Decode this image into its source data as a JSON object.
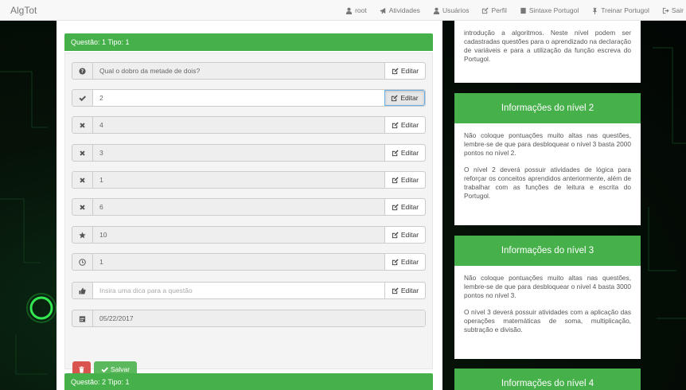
{
  "nav": {
    "brand": "AlgTot",
    "links": [
      {
        "label": "root",
        "icon": "user-icon"
      },
      {
        "label": "Atividades",
        "icon": "bullhorn-icon"
      },
      {
        "label": "Usuários",
        "icon": "user-icon"
      },
      {
        "label": "Perfil",
        "icon": "edit-icon"
      },
      {
        "label": "Sintaxe Portugol",
        "icon": "book-icon"
      },
      {
        "label": "Treinar Portugol",
        "icon": "pushpin-icon"
      },
      {
        "label": "Sair",
        "icon": "log-out-icon"
      }
    ]
  },
  "questions": [
    {
      "header": "Questão: 1 Tipo: 1",
      "rows": [
        {
          "icon": "question-icon",
          "value": "Qual o dobro da metade de dois?",
          "edit": "Editar"
        },
        {
          "icon": "check-icon",
          "value": "2",
          "edit": "Editar"
        },
        {
          "icon": "times-icon",
          "value": "4",
          "edit": "Editar"
        },
        {
          "icon": "times-icon",
          "value": "3",
          "edit": "Editar"
        },
        {
          "icon": "times-icon",
          "value": "1",
          "edit": "Editar"
        },
        {
          "icon": "times-icon",
          "value": "6",
          "edit": "Editar"
        },
        {
          "icon": "star-icon",
          "value": "10",
          "edit": "Editar"
        },
        {
          "icon": "clock-icon",
          "value": "1",
          "edit": "Editar"
        },
        {
          "icon": "thumbs-up-icon",
          "placeholder": "Insira uma dica para a questão",
          "edit": "Editar"
        }
      ],
      "date": {
        "icon": "calendar-icon",
        "value": "05/22/2017"
      },
      "save_label": "Salvar"
    },
    {
      "header": "Questão: 2 Tipo: 1"
    }
  ],
  "info": [
    {
      "title": "",
      "paragraphs": [
        "introdução a algoritmos. Neste nível podem ser cadastradas questões para o aprendizado na declaração de variáveis e para a utilização da função escreva do Portugol."
      ]
    },
    {
      "title": "Informações do nível 2",
      "paragraphs": [
        "Não coloque pontuações muito altas nas questões, lembre-se de que para desbloquear o nível 3 basta 2000 pontos no nível 2.",
        "O nível 2 deverá possuir atividades de lógica para reforçar os conceitos aprendidos anteriormente, além de trabalhar com as funções de leitura e escrita do Portugol."
      ]
    },
    {
      "title": "Informações do nível 3",
      "paragraphs": [
        "Não coloque pontuações muito altas nas questões, lembre-se de que para desbloquear o nível 4 basta 3000 pontos no nível 3.",
        "O nível 3 deverá possuir atividades com a aplicação das operações matemáticas de soma, multiplicação, subtração e divisão."
      ]
    },
    {
      "title": "Informações do nível 4",
      "paragraphs": []
    }
  ]
}
